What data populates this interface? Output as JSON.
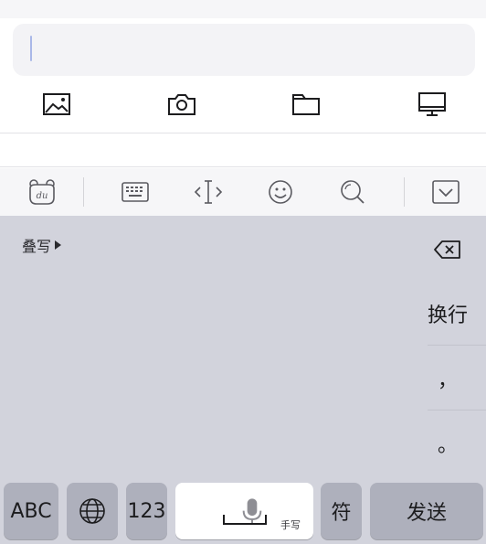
{
  "compose": {
    "placeholder": ""
  },
  "attachments": [
    {
      "icon": "image-icon"
    },
    {
      "icon": "camera-icon"
    },
    {
      "icon": "folder-icon"
    },
    {
      "icon": "monitor-icon"
    }
  ],
  "toolbar": {
    "items": [
      "du-bear-logo-icon",
      "keyboard-icon",
      "text-cursor-move-icon",
      "emoji-icon",
      "search-icon",
      "collapse-keyboard-icon"
    ]
  },
  "keyboard": {
    "overwrite_label": "叠写",
    "side_keys": {
      "delete": "",
      "newline": "换行",
      "comma": "，",
      "period": "。"
    },
    "bottom_row": {
      "abc": "ABC",
      "globe": "",
      "num": "123",
      "space_hint": "手写",
      "symbol": "符",
      "send": "发送"
    }
  },
  "colors": {
    "keyboard_bg": "#d2d3dc",
    "dark_key": "#aeb0bc",
    "cursor": "#a9b8e8"
  }
}
